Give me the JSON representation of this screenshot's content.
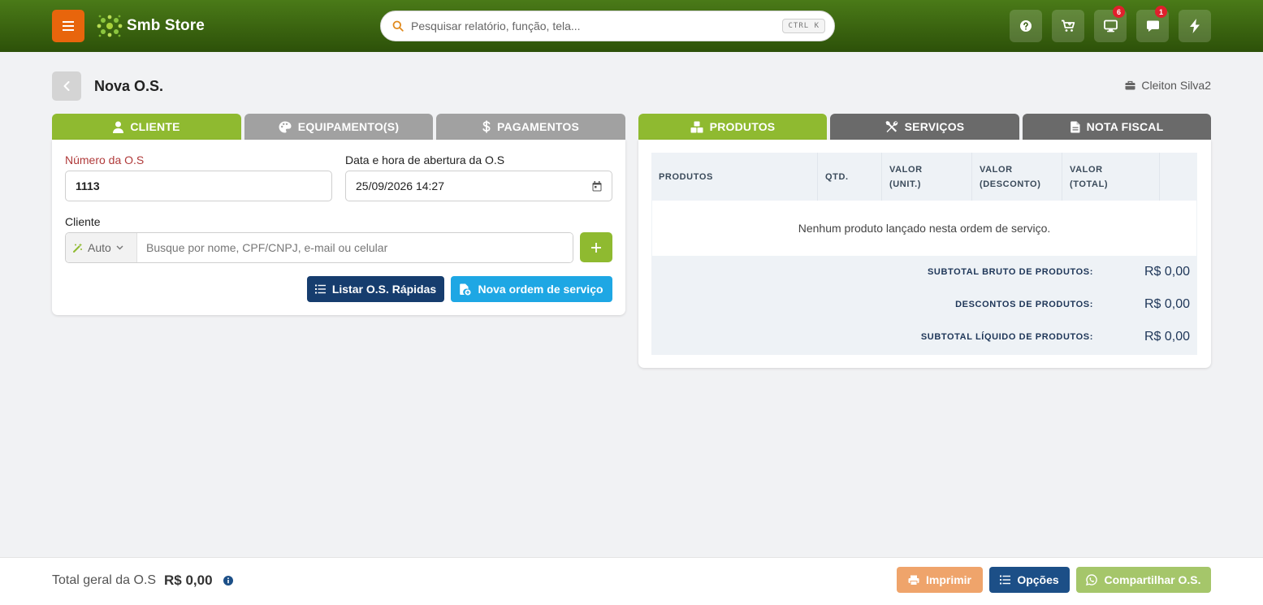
{
  "header": {
    "brand": "Smb Store",
    "search_placeholder": "Pesquisar relatório, função, tela...",
    "search_shortcut": "CTRL K",
    "badges": {
      "monitor": "6",
      "chat": "1"
    }
  },
  "page": {
    "title": "Nova O.S.",
    "user": "Cleiton Silva2"
  },
  "left_tabs": [
    {
      "label": "CLIENTE",
      "icon": "user-icon",
      "active": true
    },
    {
      "label": "EQUIPAMENTO(S)",
      "icon": "palette-icon",
      "active": false
    },
    {
      "label": "PAGAMENTOS",
      "icon": "dollar-icon",
      "active": false
    }
  ],
  "right_tabs": [
    {
      "label": "PRODUTOS",
      "icon": "boxes-icon",
      "active": true
    },
    {
      "label": "SERVIÇOS",
      "icon": "tools-icon",
      "active": false
    },
    {
      "label": "NOTA FISCAL",
      "icon": "document-icon",
      "active": false
    }
  ],
  "form": {
    "os_number_label": "Número da O.S",
    "os_number_value": "1113",
    "opened_at_label": "Data e hora de abertura da O.S",
    "opened_at_value": "25/09/2026 14:27",
    "client_label": "Cliente",
    "client_mode": "Auto",
    "client_placeholder": "Busque por nome, CPF/CNPJ, e-mail ou celular",
    "list_quick_button": "Listar O.S. Rápidas",
    "new_order_button": "Nova ordem de serviço"
  },
  "products_table": {
    "headers": [
      "PRODUTOS",
      "QTD.",
      "VALOR (UNIT.)",
      "VALOR (DESCONTO)",
      "VALOR (TOTAL)"
    ],
    "header_lines": [
      [
        "PRODUTOS"
      ],
      [
        "QTD."
      ],
      [
        "VALOR",
        "(UNIT.)"
      ],
      [
        "VALOR",
        "(DESCONTO)"
      ],
      [
        "VALOR",
        "(TOTAL)"
      ]
    ],
    "empty_message": "Nenhum produto lançado nesta ordem de serviço.",
    "summary": [
      {
        "label": "SUBTOTAL BRUTO DE PRODUTOS:",
        "value": "R$ 0,00"
      },
      {
        "label": "DESCONTOS DE PRODUTOS:",
        "value": "R$ 0,00"
      },
      {
        "label": "SUBTOTAL LÍQUIDO DE PRODUTOS:",
        "value": "R$ 0,00"
      }
    ]
  },
  "footer": {
    "total_label": "Total geral da O.S",
    "total_value": "R$ 0,00",
    "print_button": "Imprimir",
    "options_button": "Opções",
    "share_button": "Compartilhar O.S."
  },
  "colors": {
    "header_bg": "#3a6512",
    "accent_green": "#8fba30",
    "menu_orange": "#e8650c",
    "navy": "#163d6e",
    "sky": "#1ea7e4",
    "badge_red": "#e0202c"
  }
}
